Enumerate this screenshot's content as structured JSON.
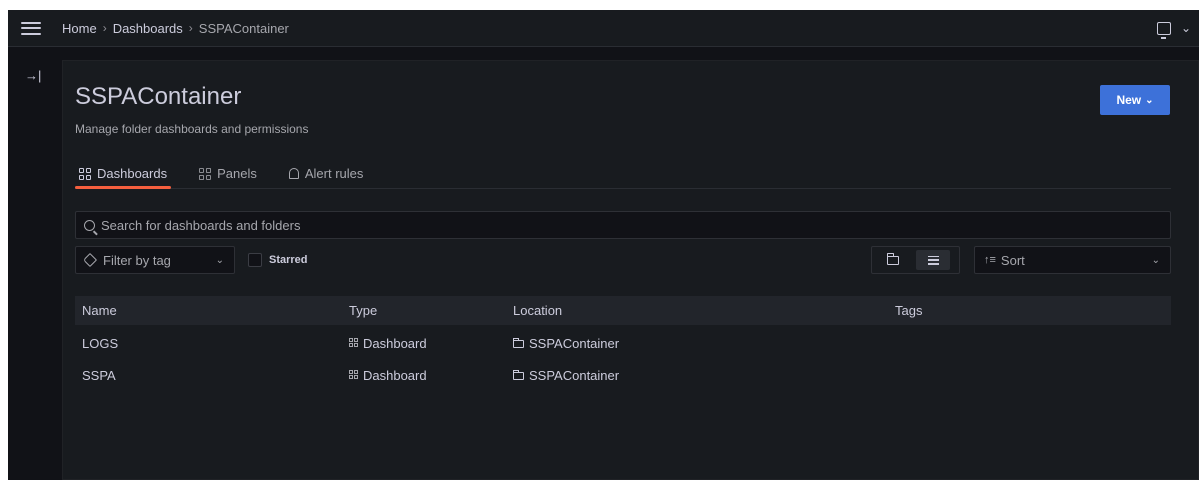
{
  "breadcrumbs": [
    "Home",
    "Dashboards",
    "SSPAContainer"
  ],
  "topbar": {
    "kiosk_icon": "monitor-icon",
    "menu_icon": "chevron-down-icon"
  },
  "sidebar": {
    "dock_icon": "→|"
  },
  "folder": {
    "title": "SSPAContainer",
    "subtitle": "Manage folder dashboards and permissions",
    "new_button": "New"
  },
  "tabs": [
    {
      "label": "Dashboards",
      "icon": "apps-icon",
      "active": true
    },
    {
      "label": "Panels",
      "icon": "library-panel-icon",
      "active": false
    },
    {
      "label": "Alert rules",
      "icon": "bell-icon",
      "active": false
    }
  ],
  "search": {
    "placeholder": "Search for dashboards and folders",
    "value": ""
  },
  "filters": {
    "tag_placeholder": "Filter by tag",
    "starred_label": "Starred",
    "sort_label": "Sort",
    "view_mode": "list"
  },
  "table": {
    "columns": [
      "Name",
      "Type",
      "Location",
      "Tags"
    ],
    "rows": [
      {
        "name": "LOGS",
        "type": "Dashboard",
        "location": "SSPAContainer",
        "tags": ""
      },
      {
        "name": "SSPA",
        "type": "Dashboard",
        "location": "SSPAContainer",
        "tags": ""
      }
    ]
  },
  "colors": {
    "primary": "#3d71d9",
    "active_tab": "#f55f3e",
    "background": "#111217",
    "panel": "#181b1f"
  }
}
